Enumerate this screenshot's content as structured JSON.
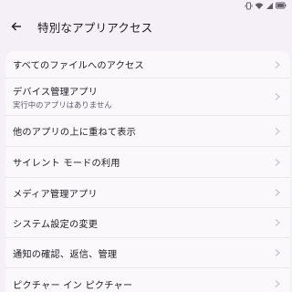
{
  "status_bar": {
    "icons": [
      "vibrate-icon",
      "wifi-icon",
      "signal-icon",
      "battery-icon"
    ]
  },
  "header": {
    "title": "特別なアプリアクセス",
    "back_icon": "back-arrow-icon"
  },
  "items": [
    {
      "label": "すべてのファイルへのアクセス",
      "subtitle": null
    },
    {
      "label": "デバイス管理アプリ",
      "subtitle": "実行中のアプリはありません"
    },
    {
      "label": "他のアプリの上に重ねて表示",
      "subtitle": null
    },
    {
      "label": "サイレント モードの利用",
      "subtitle": null
    },
    {
      "label": "メディア管理アプリ",
      "subtitle": null
    },
    {
      "label": "システム設定の変更",
      "subtitle": null
    },
    {
      "label": "通知の確認、返信、管理",
      "subtitle": null
    },
    {
      "label": "ピクチャー イン ピクチャー",
      "subtitle": null
    }
  ],
  "colors": {
    "background": "#f5eff7",
    "card": "#fbf8fc",
    "text": "#1d1b20",
    "chevron": "#c9c4cf"
  }
}
